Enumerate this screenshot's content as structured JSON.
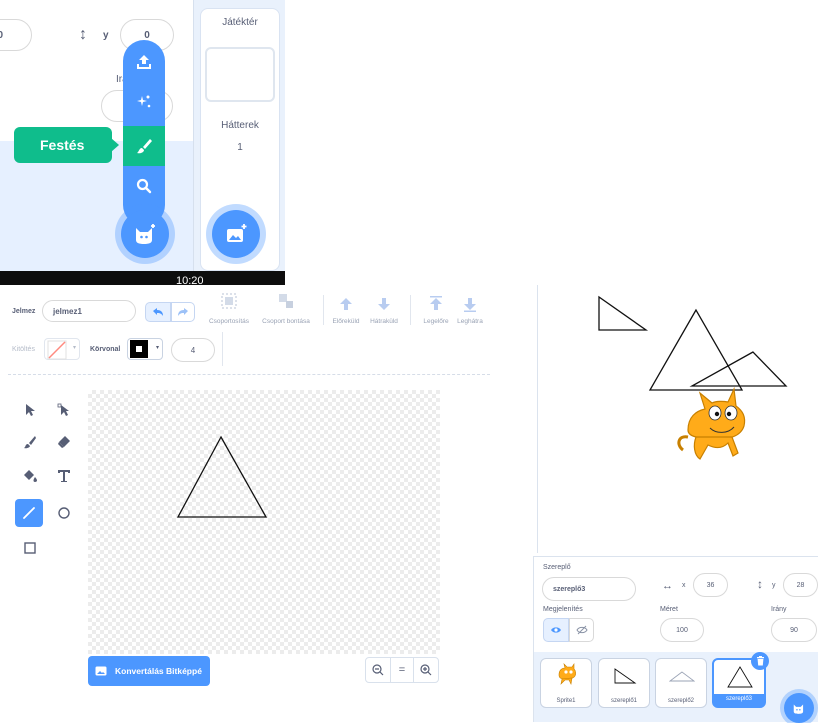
{
  "inset": {
    "x_value_partial": "0",
    "y_label": "y",
    "y_value": "0",
    "direction_label_partial": "Irány",
    "stage_title": "Játéktér",
    "backdrops_label": "Hátterek",
    "backdrops_count": "1",
    "tooltip_paint": "Festés",
    "clock": "10:20"
  },
  "editor": {
    "costume_label": "Jelmez",
    "costume_name": "jelmez1",
    "toolbar": {
      "group": "Csoportosítás",
      "ungroup": "Csoport bontása",
      "forward": "Előreküld",
      "backward": "Hátraküld",
      "front": "Legelőre",
      "back": "Leghátra"
    },
    "fill_label": "Kitöltés",
    "outline_label": "Körvonal",
    "outline_width": "4",
    "convert_button": "Konvertálás Bitképpé",
    "zoom_reset": "="
  },
  "sprite_info": {
    "sprite_label": "Szereplő",
    "sprite_name": "szereplő3",
    "x_label": "x",
    "x_value": "36",
    "y_label": "y",
    "y_value": "28",
    "show_label": "Megjelenítés",
    "size_label": "Méret",
    "size_value": "100",
    "direction_label": "Irány",
    "direction_value": "90"
  },
  "sprite_list": [
    {
      "name": "Sprite1",
      "thumb": "cat"
    },
    {
      "name": "szereplő1",
      "thumb": "right-triangle"
    },
    {
      "name": "szereplő2",
      "thumb": "flat-triangle"
    },
    {
      "name": "szereplő3",
      "thumb": "triangle",
      "selected": true
    }
  ],
  "colors": {
    "primary": "#4c97ff",
    "paint_green": "#0fbd8c",
    "text": "#575e75",
    "panel_bg": "#e9f1fc"
  },
  "icons": [
    "upload-icon",
    "surprise-icon",
    "paint-icon",
    "search-icon",
    "sprite-cat-icon",
    "backdrop-icon",
    "undo-icon",
    "redo-icon",
    "select-icon",
    "reshape-icon",
    "brush-icon",
    "eraser-icon",
    "fill-icon",
    "text-icon",
    "line-icon",
    "circle-icon",
    "rect-icon",
    "zoom-out-icon",
    "zoom-in-icon",
    "eye-icon",
    "eye-hidden-icon",
    "trash-icon"
  ]
}
